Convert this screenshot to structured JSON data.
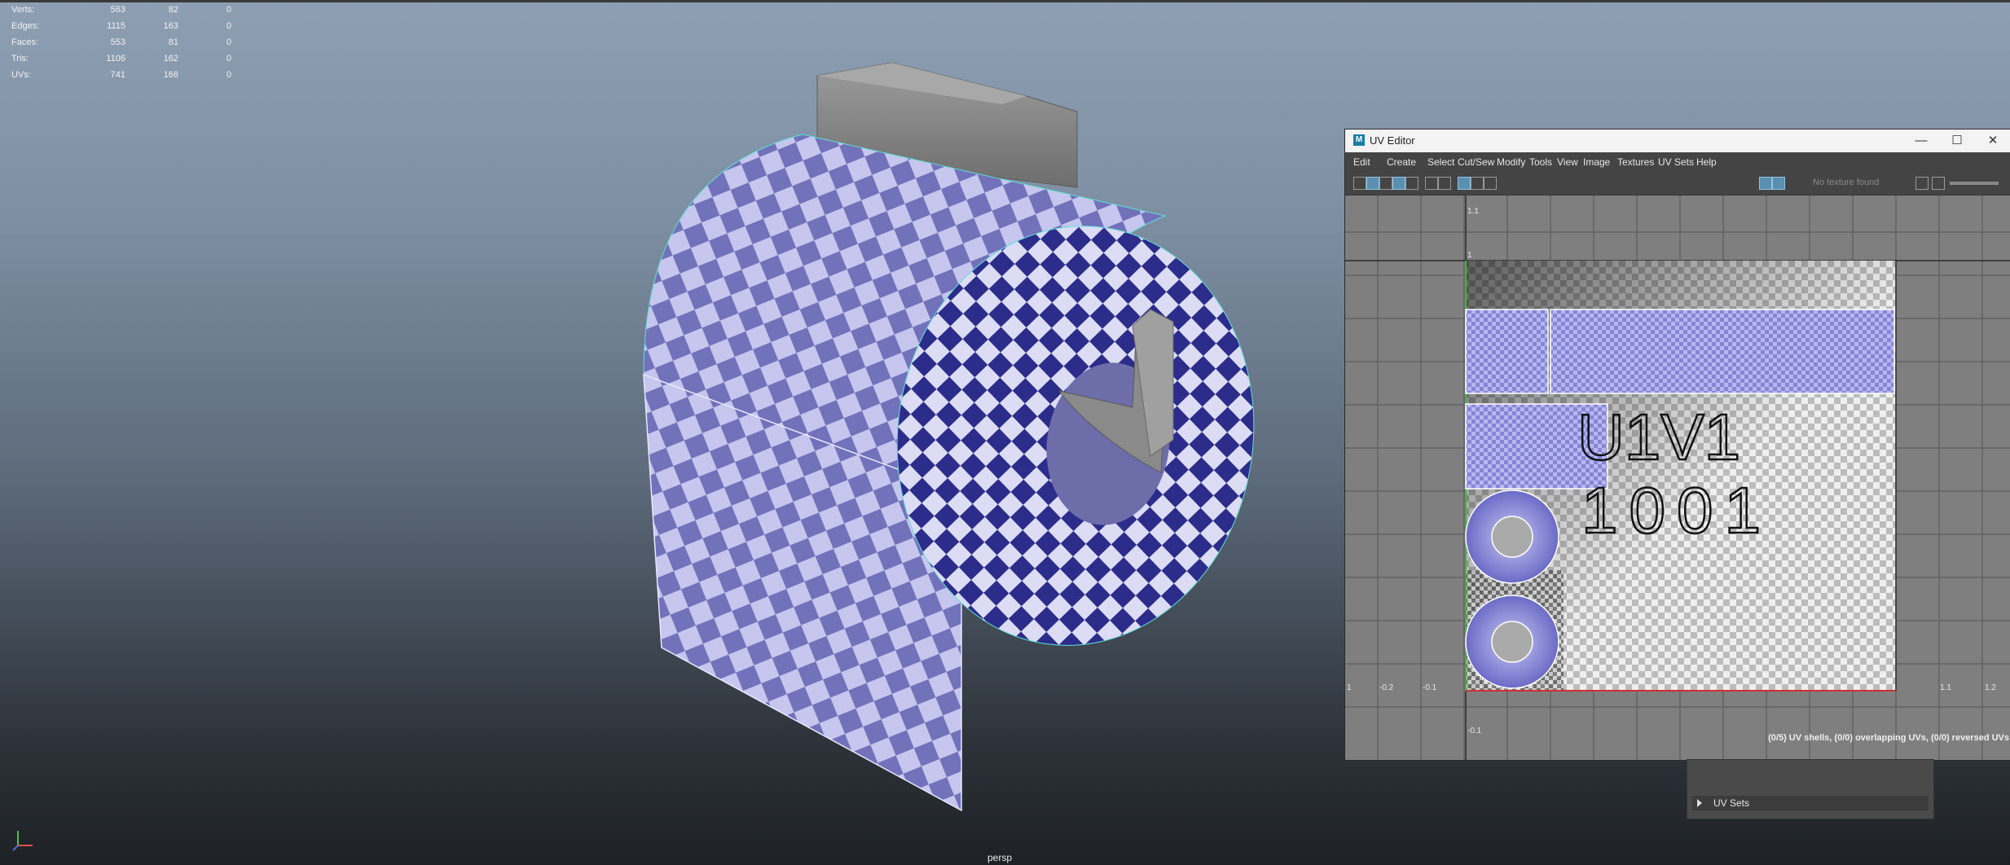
{
  "hud": {
    "rows": [
      {
        "label": "Verts:",
        "a": "563",
        "b": "82",
        "c": "0"
      },
      {
        "label": "Edges:",
        "a": "1115",
        "b": "163",
        "c": "0"
      },
      {
        "label": "Faces:",
        "a": "553",
        "b": "81",
        "c": "0"
      },
      {
        "label": "Tris:",
        "a": "1106",
        "b": "162",
        "c": "0"
      },
      {
        "label": "UVs:",
        "a": "741",
        "b": "168",
        "c": "0"
      }
    ]
  },
  "viewport": {
    "camera": "persp"
  },
  "uv_editor": {
    "title": "UV Editor",
    "logo": "M",
    "window_buttons": {
      "minimize": "—",
      "maximize": "☐",
      "close": "✕"
    },
    "menu": [
      "Edit",
      "Create",
      "Select",
      "Cut/Sew",
      "Modify",
      "Tools",
      "View",
      "Image",
      "Textures",
      "UV Sets",
      "Help"
    ],
    "texture_status": "No texture found",
    "tile_label_1": "U1V1",
    "tile_label_2": "1001",
    "ticks": {
      "top": "1.1",
      "one": "1",
      "m02": "-0.2",
      "m01": "-0.1",
      "p11": "1.1",
      "p12": "1.2",
      "m01b": "-0.1",
      "left": "1"
    },
    "status": "(0/5) UV shells, (0/0) overlapping UVs, (0/0) reversed UVs"
  },
  "side_panel": {
    "uv_sets_label": "UV Sets"
  },
  "colors": {
    "checker_light": "#c6c6ee",
    "checker_dark": "#5d5db0",
    "wire": "#5fe0d5"
  }
}
